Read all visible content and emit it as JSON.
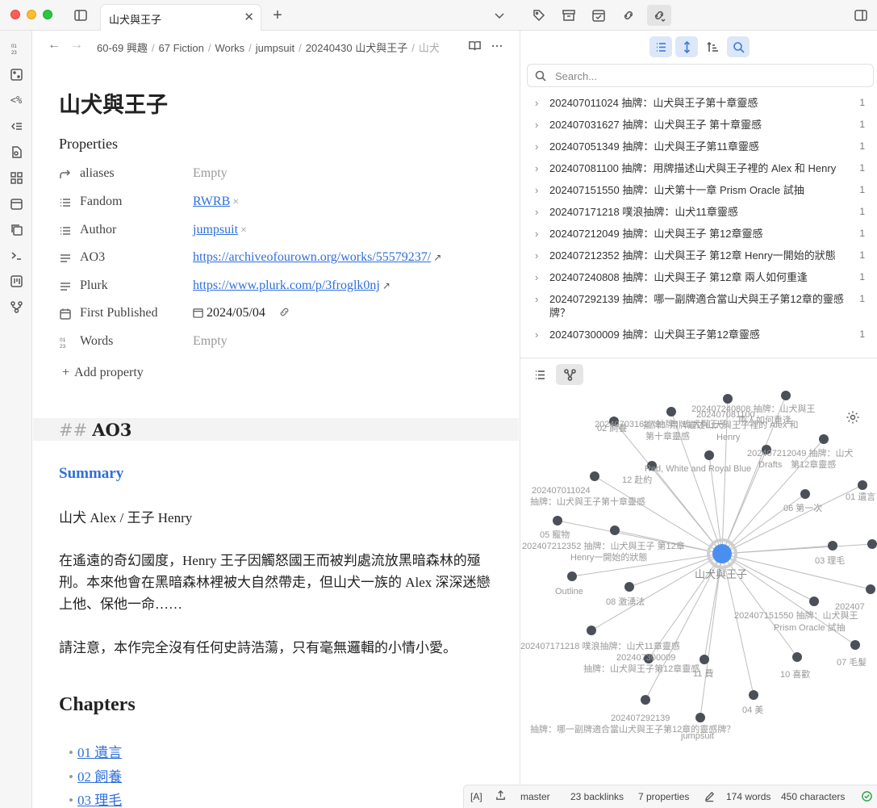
{
  "window": {
    "tab_title": "山犬與王子",
    "tab_close": "✕",
    "new_tab": "+"
  },
  "ribbon": {
    "items": [
      "quick-switch",
      "random-note",
      "templater",
      "outline",
      "canvas",
      "dashboard",
      "daily-notes",
      "copy",
      "terminal",
      "kanban",
      "graph"
    ],
    "templater_label": "<%"
  },
  "editor": {
    "breadcrumb": [
      "60-69 興趣",
      "67 Fiction",
      "Works",
      "jumpsuit",
      "20240430 山犬與王子",
      "山犬"
    ],
    "title": "山犬與王子",
    "properties_heading": "Properties",
    "properties": [
      {
        "key": "aliases",
        "value": "Empty",
        "type": "empty",
        "icon": "aliases-arrow-icon"
      },
      {
        "key": "Fandom",
        "value": "RWRB",
        "type": "tag",
        "icon": "list-icon"
      },
      {
        "key": "Author",
        "value": "jumpsuit",
        "type": "tag",
        "icon": "list-icon"
      },
      {
        "key": "AO3",
        "value": "https://archiveofourown.org/works/55579237/",
        "type": "url",
        "icon": "text-lines-icon"
      },
      {
        "key": "Plurk",
        "value": "https://www.plurk.com/p/3froglk0nj",
        "type": "url",
        "icon": "text-lines-icon"
      },
      {
        "key": "First Published",
        "value": "2024/05/04",
        "type": "date",
        "icon": "calendar-icon"
      },
      {
        "key": "Words",
        "value": "Empty",
        "type": "empty",
        "icon": "number-icon"
      }
    ],
    "add_property": "Add property",
    "h2_hash": "##",
    "h2": "AO3",
    "summary": "Summary",
    "pairing": "山犬 Alex / 王子 Henry",
    "para1": "在遙遠的奇幻國度，Henry 王子因觸怒國王而被判處流放黑暗森林的殛刑。本來他會在黑暗森林裡被大自然帶走，但山犬一族的 Alex 深深迷戀上他、保他一命……",
    "para2": "請注意，本作完全沒有任何史詩浩蕩，只有毫無邏輯的小情小愛。",
    "chapters_heading": "Chapters",
    "chapters": [
      "01 遺言",
      "02 飼養",
      "03 理毛"
    ]
  },
  "backlinks": {
    "search_placeholder": "Search...",
    "items": [
      {
        "text": "202407011024 抽牌：山犬與王子第十章靈感",
        "count": "1"
      },
      {
        "text": "202407031627 抽牌：山犬與王子 第十章靈感",
        "count": "1"
      },
      {
        "text": "202407051349 抽牌：山犬與王子第11章靈感",
        "count": "1"
      },
      {
        "text": "202407081100 抽牌：用牌描述山犬與王子裡的 Alex 和 Henry",
        "count": "1"
      },
      {
        "text": "202407151550 抽牌：山犬第十一章 Prism Oracle 試抽",
        "count": "1"
      },
      {
        "text": "202407171218 噗浪抽牌：山犬11章靈感",
        "count": "1"
      },
      {
        "text": "202407212049 抽牌：山犬與王子 第12章靈感",
        "count": "1"
      },
      {
        "text": "202407212352 抽牌：山犬與王子 第12章 Henry一開始的狀態",
        "count": "1"
      },
      {
        "text": "202407240808 抽牌：山犬與王子 第12章 兩人如何重逢",
        "count": "1"
      },
      {
        "text": "202407292139 抽牌：哪一副牌適合當山犬與王子第12章的靈感牌？",
        "count": "1"
      },
      {
        "text": "202407300009 抽牌：山犬與王子第12章靈感",
        "count": "1"
      }
    ]
  },
  "graph": {
    "center_label": "山犬與王子",
    "labels": [
      "202407240808 抽牌：山犬與王",
      "兩人如何重逢",
      "202407081100",
      "抽牌：用牌描述山犬與王子裡的 Alex 和",
      "Henry",
      "202407031627 抽牌：山犬與王子",
      "第十章靈感",
      "02 飼養",
      "Drafts",
      "202407212049 抽牌：山犬",
      "第12章靈感",
      "Red, White and Royal Blue",
      "12 赴約",
      "202407011024",
      "抽牌：山犬與王子第十章靈感",
      "06 第一次",
      "01 遺言",
      "05 寵物",
      "202407212352 抽牌：山犬與王子 第12章",
      "Henry一開始的狀態",
      "03 理毛",
      "Outline",
      "08 激湧法",
      "202407151550 抽牌：山犬與王",
      "Prism Oracle 試抽",
      "202407171218 噗浪抽牌：山犬11章靈感",
      "202407300009",
      "抽牌：山犬與王子第12章靈感",
      "11 費",
      "10 喜歡",
      "07 毛髮",
      "04 美",
      "202407292139",
      "抽牌：哪一副牌適合當山犬與王子第12章的靈感牌？",
      "jumpsuit",
      "202407"
    ]
  },
  "status": {
    "mode": "[A]",
    "branch": "master",
    "backlinks": "23 backlinks",
    "properties": "7 properties",
    "words": "174 words",
    "characters": "450 characters"
  }
}
